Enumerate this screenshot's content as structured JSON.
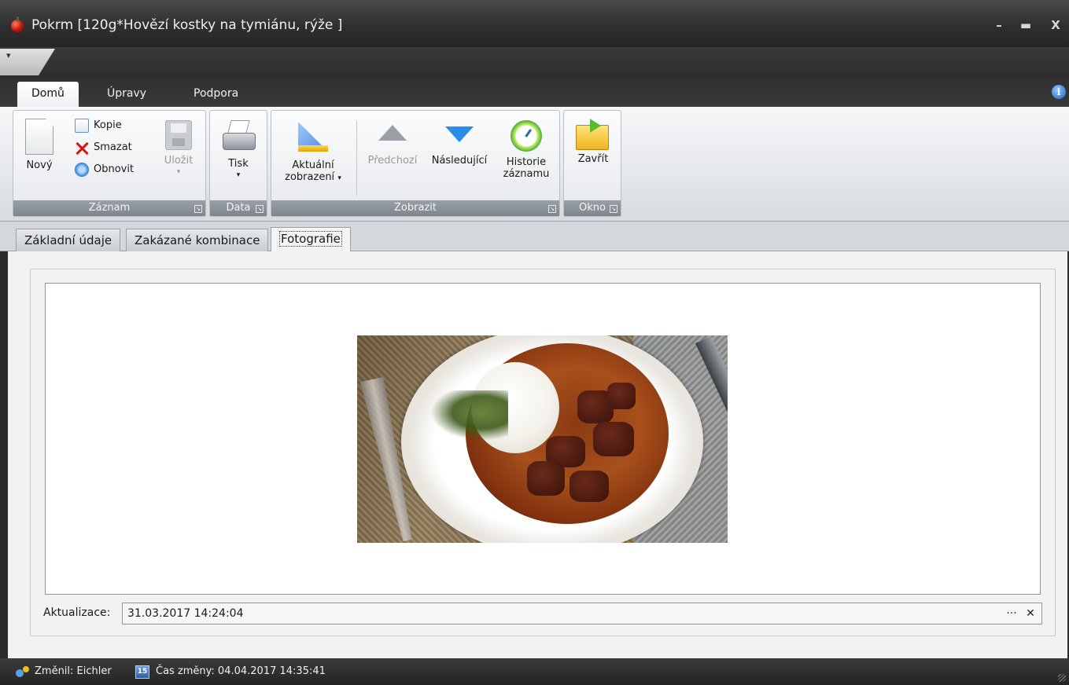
{
  "window": {
    "title": "Pokrm [120g*Hovězí kostky na tymiánu, rýže ]",
    "minimize": "–",
    "maximize": "▬",
    "close": "X"
  },
  "ribbon_tabs": [
    {
      "label": "Domů",
      "active": true
    },
    {
      "label": "Úpravy",
      "active": false
    },
    {
      "label": "Podpora",
      "active": false
    }
  ],
  "ribbon": {
    "groups": {
      "zaznam": {
        "label": "Záznam",
        "new": "Nový",
        "copy": "Kopie",
        "delete": "Smazat",
        "refresh": "Obnovit",
        "save": "Uložit"
      },
      "data": {
        "label": "Data",
        "print": "Tisk"
      },
      "zobrazit": {
        "label": "Zobrazit",
        "current_view_line1": "Aktuální",
        "current_view_line2": "zobrazení",
        "previous": "Předchozí",
        "next": "Následující",
        "history_line1": "Historie",
        "history_line2": "záznamu"
      },
      "okno": {
        "label": "Okno",
        "close": "Zavřít"
      }
    }
  },
  "doc_tabs": [
    {
      "label": "Základní údaje",
      "active": false
    },
    {
      "label": "Zakázané kombinace",
      "active": false
    },
    {
      "label": "Fotografie",
      "active": true
    }
  ],
  "photo_panel": {
    "update_label": "Aktualizace:",
    "update_value": "31.03.2017 14:24:04",
    "ellipsis_button": "···",
    "clear_button": "✕"
  },
  "status": {
    "changed_by": "Změnil: Eichler",
    "calendar_icon_text": "15",
    "changed_time": "Čas změny: 04.04.2017 14:35:41"
  },
  "colors": {
    "accent_blue": "#2a8de8",
    "delete_red": "#d9140c",
    "titlebar": "#2f2f2f"
  }
}
